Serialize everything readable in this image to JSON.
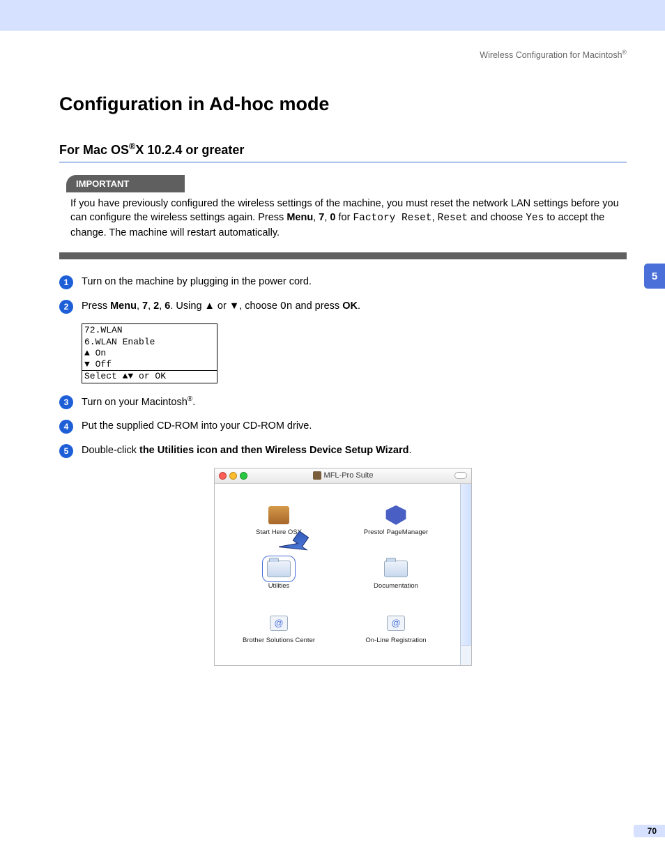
{
  "header": {
    "breadcrumb": "Wireless Configuration for Macintosh",
    "reg": "®"
  },
  "title": "Configuration in Ad-hoc mode",
  "subtitle_parts": {
    "pre": "For Mac OS",
    "reg": "®",
    "post": "X 10.2.4 or greater"
  },
  "important": {
    "label": "IMPORTANT",
    "text_pre": "If you have previously configured the wireless settings of the machine, you must reset the network LAN settings before you can configure the wireless settings again. Press ",
    "menu": "Menu",
    "sep1": ", ",
    "k7": "7",
    "sep2": ", ",
    "k0": "0",
    "for": " for ",
    "factory": "Factory Reset",
    "sep3": ", ",
    "reset": "Reset",
    "and": " and choose ",
    "yes": "Yes",
    "tail": " to accept the change. The machine will restart automatically."
  },
  "steps": {
    "s1": "Turn on the machine by plugging in the power cord.",
    "s2": {
      "pre": "Press ",
      "menu": "Menu",
      "c1": ", ",
      "k7": "7",
      "c2": ", ",
      "k2": "2",
      "c3": ", ",
      "k6": "6",
      "using": ". Using ▲ or ▼, choose ",
      "on": "On",
      "press": " and press ",
      "ok": "OK",
      "dot": "."
    },
    "s3": {
      "pre": "Turn on your Macintosh",
      "reg": "®",
      "dot": "."
    },
    "s4": "Put the supplied CD-ROM into your CD-ROM drive.",
    "s5": {
      "pre": "Double-click ",
      "bold": "the Utilities icon and then Wireless Device Setup Wizard",
      "dot": "."
    }
  },
  "lcd": {
    "l1": "72.WLAN",
    "l2": "  6.WLAN Enable",
    "l3": "▲    On",
    "l4": "▼    Off",
    "l5": "Select ▲▼ or OK"
  },
  "finder": {
    "title": "MFL-Pro Suite",
    "items": {
      "i1": "Start Here OSX",
      "i2": "Presto! PageManager",
      "i3": "Utilities",
      "i4": "Documentation",
      "i5": "Brother Solutions Center",
      "i6": "On-Line Registration"
    }
  },
  "sidetab": "5",
  "pagenum": "70"
}
